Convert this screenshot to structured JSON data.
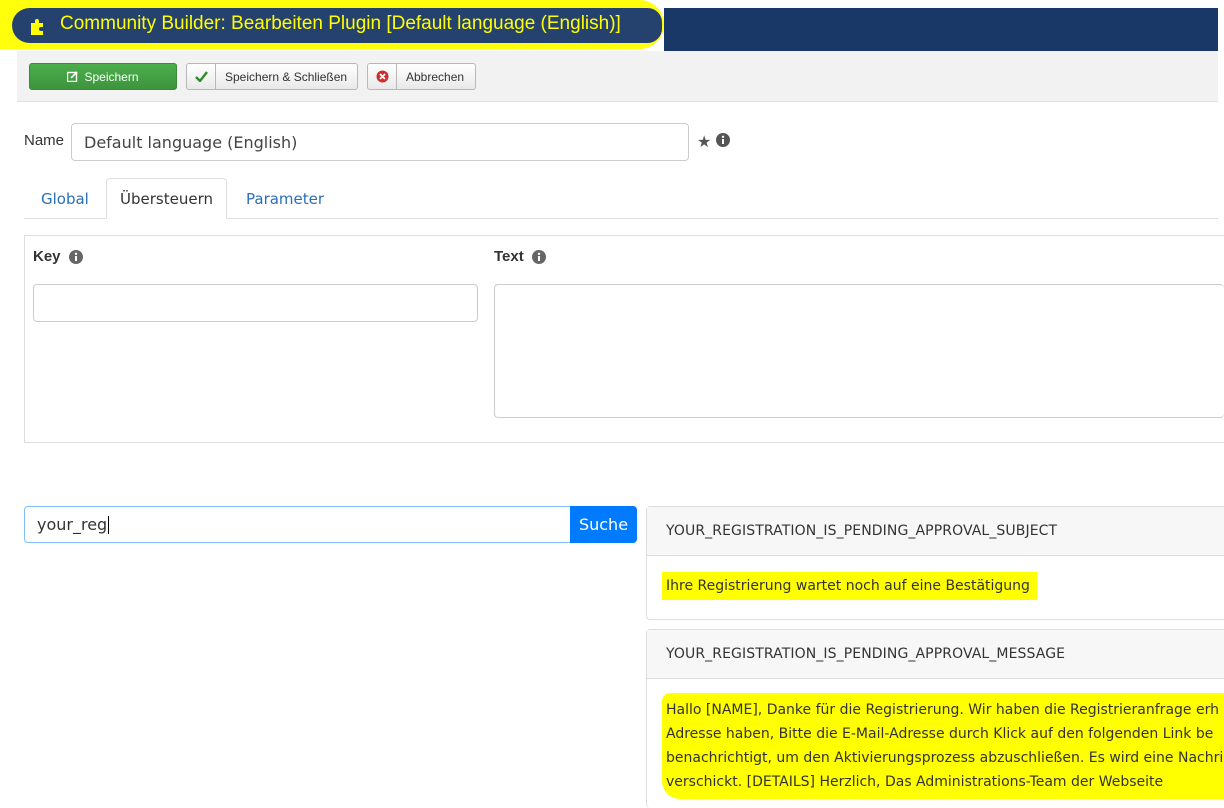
{
  "header": {
    "title": "Community Builder: Bearbeiten Plugin [Default language (English)]",
    "icon": "puzzle-icon"
  },
  "toolbar": {
    "save_label": "Speichern",
    "save_close_label": "Speichern & Schließen",
    "cancel_label": "Abbrechen"
  },
  "form": {
    "name_label": "Name",
    "name_value": "Default language (English)"
  },
  "tabs": [
    {
      "label": "Global"
    },
    {
      "label": "Übersteuern"
    },
    {
      "label": "Parameter"
    }
  ],
  "override": {
    "key_label": "Key",
    "text_label": "Text",
    "key_value": "",
    "text_value": ""
  },
  "search": {
    "value": "your_reg",
    "button_label": "Suche"
  },
  "results": [
    {
      "key": "YOUR_REGISTRATION_IS_PENDING_APPROVAL_SUBJECT",
      "text": "Ihre Registrierung wartet noch auf eine Bestätigung"
    },
    {
      "key": "YOUR_REGISTRATION_IS_PENDING_APPROVAL_MESSAGE",
      "lines": [
        "Hallo [NAME], Danke für die Registrierung. Wir haben die Registrieranfrage erh",
        "Adresse haben, Bitte die E-Mail-Adresse durch Klick auf den folgenden Link be",
        "benachrichtigt, um den Aktivierungsprozess abzuschließen. Es wird eine Nachri",
        "verschickt. [DETAILS] Herzlich, Das Administrations-Team der Webseite"
      ]
    }
  ],
  "colors": {
    "header_bg": "#1a3867",
    "highlight": "#ffff00",
    "save_button": "#46a546",
    "search_button": "#007bff",
    "link": "#2a6ebb"
  }
}
